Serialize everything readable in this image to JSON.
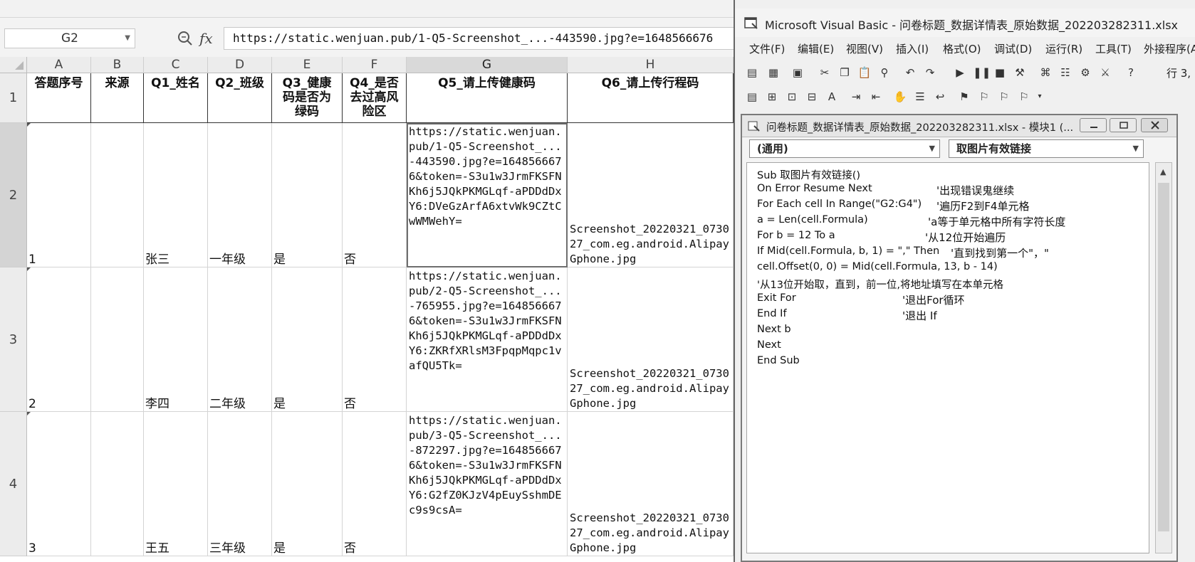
{
  "sheet": {
    "namebox": "G2",
    "formula": "https://static.wenjuan.pub/1-Q5-Screenshot_...-443590.jpg?e=1648566676",
    "columns": [
      "A",
      "B",
      "C",
      "D",
      "E",
      "F",
      "G",
      "H"
    ],
    "row_numbers": [
      "1",
      "2",
      "3",
      "4"
    ],
    "headers": [
      "答题序号",
      "来源",
      "Q1_姓名",
      "Q2_班级",
      "Q3_健康码是否为绿码",
      "Q4_是否去过高风险区",
      "Q5_请上传健康码",
      "Q6_请上传行程码"
    ],
    "rows": [
      {
        "id": "1",
        "source": "",
        "name": "张三",
        "grade": "一年级",
        "q3": "是",
        "q4": "否",
        "q5": "https://static.wenjuan.pub/1-Q5-Screenshot_...-443590.jpg?e=1648566676&token=-S3u1w3JrmFKSFNKh6j5JQkPKMGLqf-aPDDdDxY6:DVeGzArfA6xtvWk9CZtCwWMWehY=",
        "q6": "Screenshot_20220321_073027_com.eg.android.AlipayGphone.jpg"
      },
      {
        "id": "2",
        "source": "",
        "name": "李四",
        "grade": "二年级",
        "q3": "是",
        "q4": "否",
        "q5": "https://static.wenjuan.pub/2-Q5-Screenshot_...-765955.jpg?e=1648566676&token=-S3u1w3JrmFKSFNKh6j5JQkPKMGLqf-aPDDdDxY6:ZKRfXRlsM3FpqpMqpc1vafQU5Tk=",
        "q6": "Screenshot_20220321_073027_com.eg.android.AlipayGphone.jpg"
      },
      {
        "id": "3",
        "source": "",
        "name": "王五",
        "grade": "三年级",
        "q3": "是",
        "q4": "否",
        "q5": "https://static.wenjuan.pub/3-Q5-Screenshot_...-872297.jpg?e=1648566676&token=-S3u1w3JrmFKSFNKh6j5JQkPKMGLqf-aPDDdDxY6:G2fZ0KJzV4pEuySshmDEc9s9csA=",
        "q6": "Screenshot_20220321_073027_com.eg.android.AlipayGphone.jpg"
      }
    ]
  },
  "vbe": {
    "title": "Microsoft Visual Basic - 问卷标题_数据详情表_原始数据_202203282311.xlsx",
    "menu": [
      "文件(F)",
      "编辑(E)",
      "视图(V)",
      "插入(I)",
      "格式(O)",
      "调试(D)",
      "运行(R)",
      "工具(T)",
      "外接程序(A)"
    ],
    "row_indicator": "行 3,",
    "code_window_title": "问卷标题_数据详情表_原始数据_202203282311.xlsx - 模块1 (...",
    "object_combo": "(通用)",
    "proc_combo": "取图片有效链接",
    "code_lines": [
      {
        "code": "Sub 取图片有效链接()",
        "comment": ""
      },
      {
        "code": "On Error Resume Next",
        "comment": "'出现错误鬼继续"
      },
      {
        "code": "For Each cell In Range(\"G2:G4\")",
        "comment": "'遍历F2到F4单元格"
      },
      {
        "code": "  a = Len(cell.Formula)",
        "comment": "'a等于单元格中所有字符长度"
      },
      {
        "code": "  For b = 12 To a",
        "comment": "'从12位开始遍历"
      },
      {
        "code": "  If Mid(cell.Formula, b, 1) = \",\" Then",
        "comment": "'直到找到第一个\"，\""
      },
      {
        "code": "  cell.Offset(0, 0) = Mid(cell.Formula, 13, b - 14)",
        "comment": ""
      },
      {
        "code": "'从13位开始取，直到，前一位,将地址填写在本单元格",
        "comment": ""
      },
      {
        "code": "  Exit For",
        "comment": "'退出For循环"
      },
      {
        "code": "  End If",
        "comment": "'退出 If"
      },
      {
        "code": "  Next b",
        "comment": ""
      },
      {
        "code": "  Next",
        "comment": ""
      },
      {
        "code": "End Sub",
        "comment": ""
      }
    ]
  }
}
